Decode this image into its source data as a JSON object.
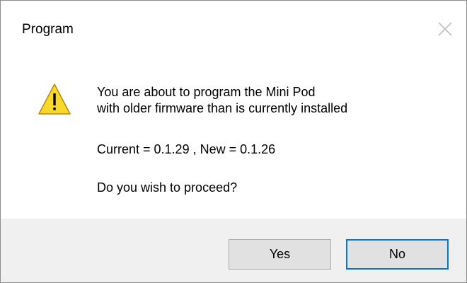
{
  "dialog": {
    "title": "Program",
    "close_icon": "close-icon",
    "warning_icon": "warning-icon",
    "message": {
      "line1": "You are about to program the Mini Pod",
      "line2": "with older firmware than is currently installed",
      "versions": "Current = 0.1.29  ,  New = 0.1.26",
      "question": "Do you wish to proceed?"
    },
    "buttons": {
      "yes_label": "Yes",
      "no_label": "No"
    }
  },
  "colors": {
    "accent": "#0078d7",
    "warning_fill": "#f8d92a",
    "footer_bg": "#f0f0f0"
  }
}
